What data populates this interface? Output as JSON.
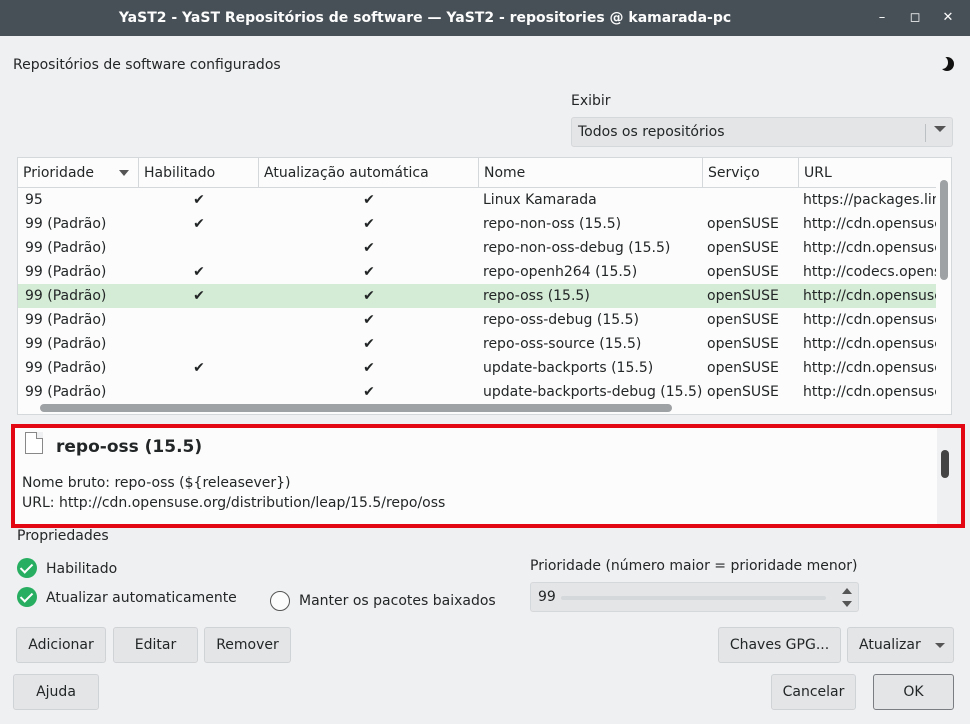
{
  "window": {
    "title": "YaST2 - YaST Repositórios de software — YaST2 - repositories @ kamarada-pc",
    "minimize": "–",
    "maximize": "◻",
    "close": "✕"
  },
  "heading": "Repositórios de software configurados",
  "filter": {
    "label": "Exibir",
    "value": "Todos os repositórios"
  },
  "table": {
    "columns": [
      "Prioridade",
      "Habilitado",
      "Atualização automática",
      "Nome",
      "Serviço",
      "URL"
    ],
    "rows": [
      {
        "priority": "95",
        "enabled": "✔",
        "autoref": "✔",
        "name": "Linux Kamarada",
        "service": "",
        "url": "https://packages.linuxkamarada.com/"
      },
      {
        "priority": "99 (Padrão)",
        "enabled": "✔",
        "autoref": "✔",
        "name": "repo-non-oss (15.5)",
        "service": "openSUSE",
        "url": "http://cdn.opensuse.org/"
      },
      {
        "priority": "99 (Padrão)",
        "enabled": "",
        "autoref": "✔",
        "name": "repo-non-oss-debug (15.5)",
        "service": "openSUSE",
        "url": "http://cdn.opensuse.org/"
      },
      {
        "priority": "99 (Padrão)",
        "enabled": "✔",
        "autoref": "✔",
        "name": "repo-openh264 (15.5)",
        "service": "openSUSE",
        "url": "http://codecs.opensuse.org/"
      },
      {
        "priority": "99 (Padrão)",
        "enabled": "✔",
        "autoref": "✔",
        "name": "repo-oss (15.5)",
        "service": "openSUSE",
        "url": "http://cdn.opensuse.org/"
      },
      {
        "priority": "99 (Padrão)",
        "enabled": "",
        "autoref": "✔",
        "name": "repo-oss-debug (15.5)",
        "service": "openSUSE",
        "url": "http://cdn.opensuse.org/"
      },
      {
        "priority": "99 (Padrão)",
        "enabled": "",
        "autoref": "✔",
        "name": "repo-oss-source (15.5)",
        "service": "openSUSE",
        "url": "http://cdn.opensuse.org/"
      },
      {
        "priority": "99 (Padrão)",
        "enabled": "✔",
        "autoref": "✔",
        "name": "update-backports (15.5)",
        "service": "openSUSE",
        "url": "http://cdn.opensuse.org/"
      },
      {
        "priority": "99 (Padrão)",
        "enabled": "",
        "autoref": "✔",
        "name": "update-backports-debug (15.5)",
        "service": "openSUSE",
        "url": "http://cdn.opensuse.org/"
      }
    ],
    "selected_index": 4
  },
  "detail": {
    "name": "repo-oss (15.5)",
    "raw_name": "Nome bruto: repo-oss (${releasever})",
    "url": "URL: http://cdn.opensuse.org/distribution/leap/15.5/repo/oss"
  },
  "properties": {
    "label": "Propriedades",
    "enabled": "Habilitado",
    "autorefresh": "Atualizar automaticamente",
    "keep_packages": "Manter os pacotes baixados",
    "priority_label": "Prioridade (número maior = prioridade menor)",
    "priority_value": "99"
  },
  "buttons": {
    "add": "Adicionar",
    "edit": "Editar",
    "remove": "Remover",
    "gpg": "Chaves GPG...",
    "refresh": "Atualizar",
    "help": "Ajuda",
    "cancel": "Cancelar",
    "ok": "OK"
  },
  "colors": {
    "accent": "#27ae60",
    "selection": "#d4ebd5",
    "highlight_border": "#e30613",
    "titlebar": "#475057"
  }
}
